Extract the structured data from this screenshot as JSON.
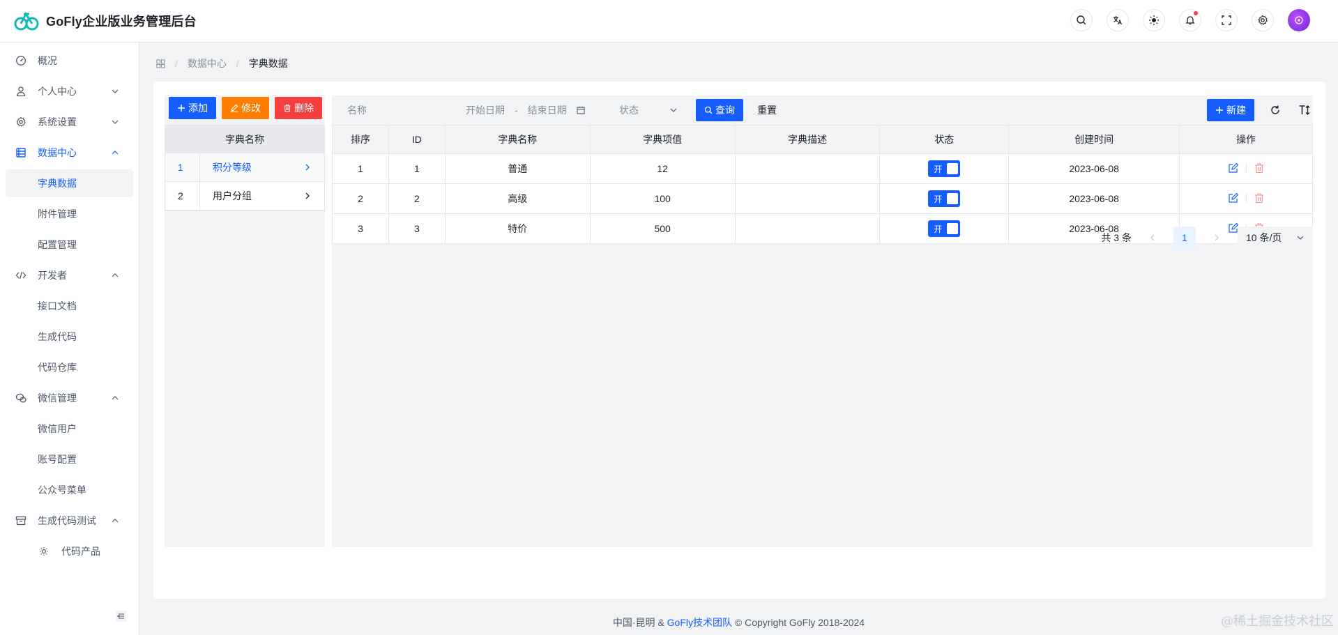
{
  "app": {
    "title": "GoFly企业版业务管理后台"
  },
  "sidebar": {
    "items": [
      {
        "label": "概况"
      },
      {
        "label": "个人中心"
      },
      {
        "label": "系统设置"
      },
      {
        "label": "数据中心"
      },
      {
        "label": "开发者"
      },
      {
        "label": "微信管理"
      },
      {
        "label": "生成代码测试"
      }
    ],
    "data_children": [
      {
        "label": "字典数据"
      },
      {
        "label": "附件管理"
      },
      {
        "label": "配置管理"
      }
    ],
    "dev_children": [
      {
        "label": "接口文档"
      },
      {
        "label": "生成代码"
      },
      {
        "label": "代码仓库"
      }
    ],
    "wechat_children": [
      {
        "label": "微信用户"
      },
      {
        "label": "账号配置"
      },
      {
        "label": "公众号菜单"
      }
    ],
    "gen_children": [
      {
        "label": "代码产品"
      }
    ]
  },
  "breadcrumb": {
    "level1": "数据中心",
    "level2": "字典数据",
    "sep": "/"
  },
  "left_panel": {
    "add_label": "添加",
    "edit_label": "修改",
    "delete_label": "删除",
    "header": "字典名称",
    "rows": [
      {
        "index": "1",
        "name": "积分等级"
      },
      {
        "index": "2",
        "name": "用户分组"
      }
    ]
  },
  "filters": {
    "name_placeholder": "名称",
    "start_date_placeholder": "开始日期",
    "date_separator": "-",
    "end_date_placeholder": "结束日期",
    "status_placeholder": "状态",
    "query_label": "查询",
    "reset_label": "重置",
    "new_label": "新建"
  },
  "table": {
    "headers": [
      "排序",
      "ID",
      "字典名称",
      "字典项值",
      "字典描述",
      "状态",
      "创建时间",
      "操作"
    ],
    "rows": [
      {
        "order": "1",
        "id": "1",
        "name": "普通",
        "value": "12",
        "desc": "",
        "status": "开",
        "created": "2023-06-08"
      },
      {
        "order": "2",
        "id": "2",
        "name": "高级",
        "value": "100",
        "desc": "",
        "status": "开",
        "created": "2023-06-08"
      },
      {
        "order": "3",
        "id": "3",
        "name": "特价",
        "value": "500",
        "desc": "",
        "status": "开",
        "created": "2023-06-08"
      }
    ]
  },
  "pagination": {
    "total": "共 3 条",
    "current": "1",
    "page_size": "10 条/页"
  },
  "footer": {
    "prefix": "中国·昆明 & ",
    "team": "GoFly技术团队",
    "suffix": " © Copyright GoFly 2018-2024"
  },
  "watermark": "@稀土掘金技术社区",
  "colors": {
    "primary": "#165dff",
    "orange": "#ff7d00",
    "danger": "#f53f3f"
  }
}
